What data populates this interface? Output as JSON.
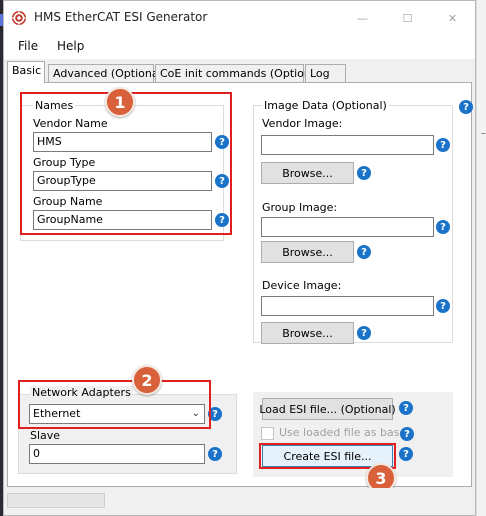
{
  "window": {
    "title": "HMS EtherCAT ESI Generator",
    "controls": {
      "minimize": "—",
      "maximize": "☐",
      "close": "✕"
    }
  },
  "menu": {
    "file": "File",
    "help": "Help"
  },
  "tabs": {
    "basic": "Basic",
    "advanced": "Advanced (Optional)",
    "coe": "CoE init commands (Optional)",
    "log": "Log",
    "active": "Basic"
  },
  "names": {
    "group_title": "Names",
    "vendor_name_label": "Vendor Name",
    "vendor_name_value": "HMS",
    "group_type_label": "Group Type",
    "group_type_value": "GroupType",
    "group_name_label": "Group Name",
    "group_name_value": "GroupName"
  },
  "image_data": {
    "group_title": "Image Data (Optional)",
    "vendor_image_label": "Vendor Image:",
    "vendor_image_value": "",
    "group_image_label": "Group Image:",
    "group_image_value": "",
    "device_image_label": "Device Image:",
    "device_image_value": "",
    "browse_label": "Browse..."
  },
  "network": {
    "group_title": "Network Adapters",
    "adapter_selected": "Ethernet",
    "slave_label": "Slave",
    "slave_value": "0"
  },
  "esi": {
    "load_label": "Load ESI file... (Optional)",
    "use_loaded_label": "Use loaded file as base.",
    "use_loaded_checked": false,
    "create_label": "Create ESI file..."
  },
  "help_glyph": "?",
  "annotations": [
    "1",
    "2",
    "3"
  ],
  "colors": {
    "highlight": "#e02020",
    "badge": "#d8603a",
    "help": "#1a73c9"
  }
}
